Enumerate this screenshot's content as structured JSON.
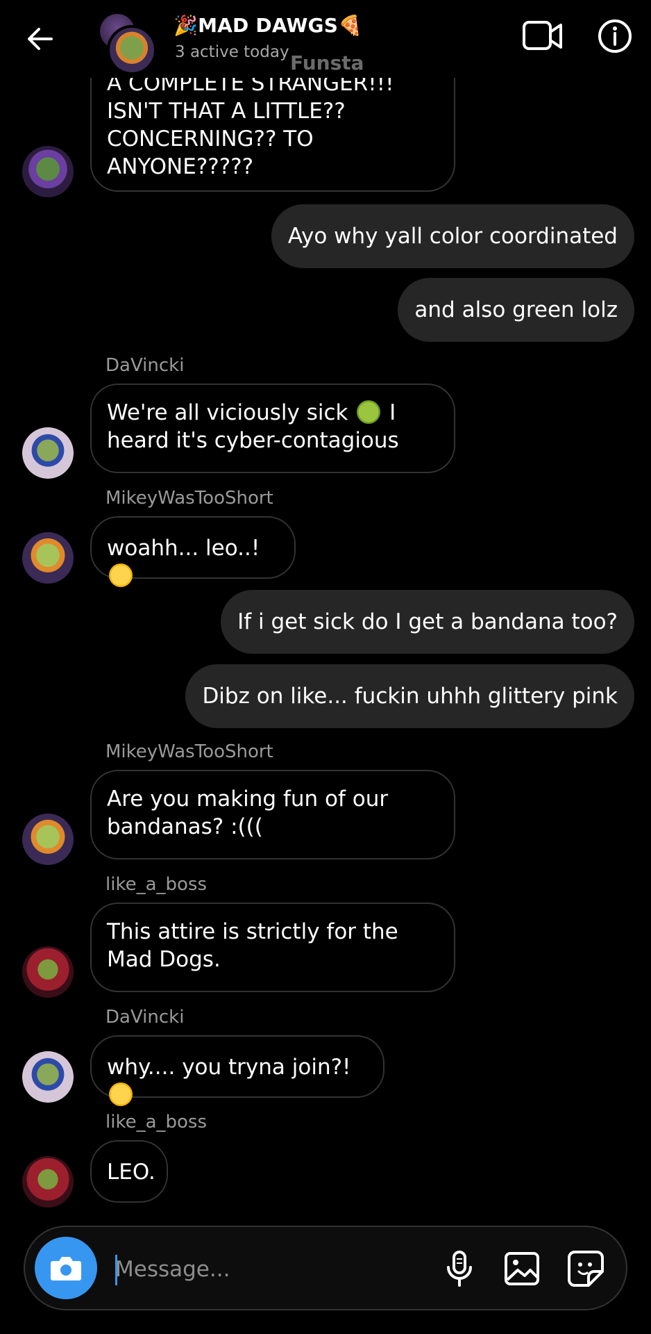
{
  "header": {
    "title": "🎉MAD DAWGS🍕",
    "subtitle": "3 active today",
    "faded_label": "Funsta"
  },
  "messages": [
    {
      "direction": "in",
      "sender": "",
      "avatar": "donnie",
      "text": "A COMPLETE STRANGER!!!\nISN'T THAT A LITTLE??\nCONCERNING?? TO\nANYONE?????"
    },
    {
      "direction": "out",
      "text": "Ayo why yall color coordinated"
    },
    {
      "direction": "out",
      "text": "and also green lolz"
    },
    {
      "direction": "in",
      "sender": "DaVincki",
      "avatar": "leo",
      "text": "We're all viciously sick 🤢 I heard it's cyber-contagious"
    },
    {
      "direction": "in",
      "sender": "MikeyWasTooShort",
      "avatar": "mikey",
      "text": "woahh... leo..! 😲"
    },
    {
      "direction": "out",
      "text": "If i get sick do I get a bandana too?"
    },
    {
      "direction": "out",
      "text": "Dibz on like... fuckin uhhh glittery pink"
    },
    {
      "direction": "in",
      "sender": "MikeyWasTooShort",
      "avatar": "mikey",
      "text": "Are you making fun of our bandanas? :((("
    },
    {
      "direction": "in",
      "sender": "like_a_boss",
      "avatar": "raph",
      "text": "This attire is strictly for the Mad Dogs."
    },
    {
      "direction": "in",
      "sender": "DaVincki",
      "avatar": "leo",
      "text": "why.... you tryna join?! 🧐"
    },
    {
      "direction": "in",
      "sender": "like_a_boss",
      "avatar": "raph",
      "text": "LEO."
    }
  ],
  "composer": {
    "placeholder": "Message..."
  },
  "icons": {
    "back": "arrow-left-icon",
    "video": "video-camera-icon",
    "info": "info-icon",
    "camera": "camera-icon",
    "mic": "microphone-icon",
    "gallery": "image-icon",
    "sticker": "sticker-icon"
  },
  "colors": {
    "background": "#000000",
    "outgoing_bubble": "#262626",
    "incoming_border": "#333333",
    "accent": "#3797f0",
    "sender_text": "#9a9a9a"
  }
}
